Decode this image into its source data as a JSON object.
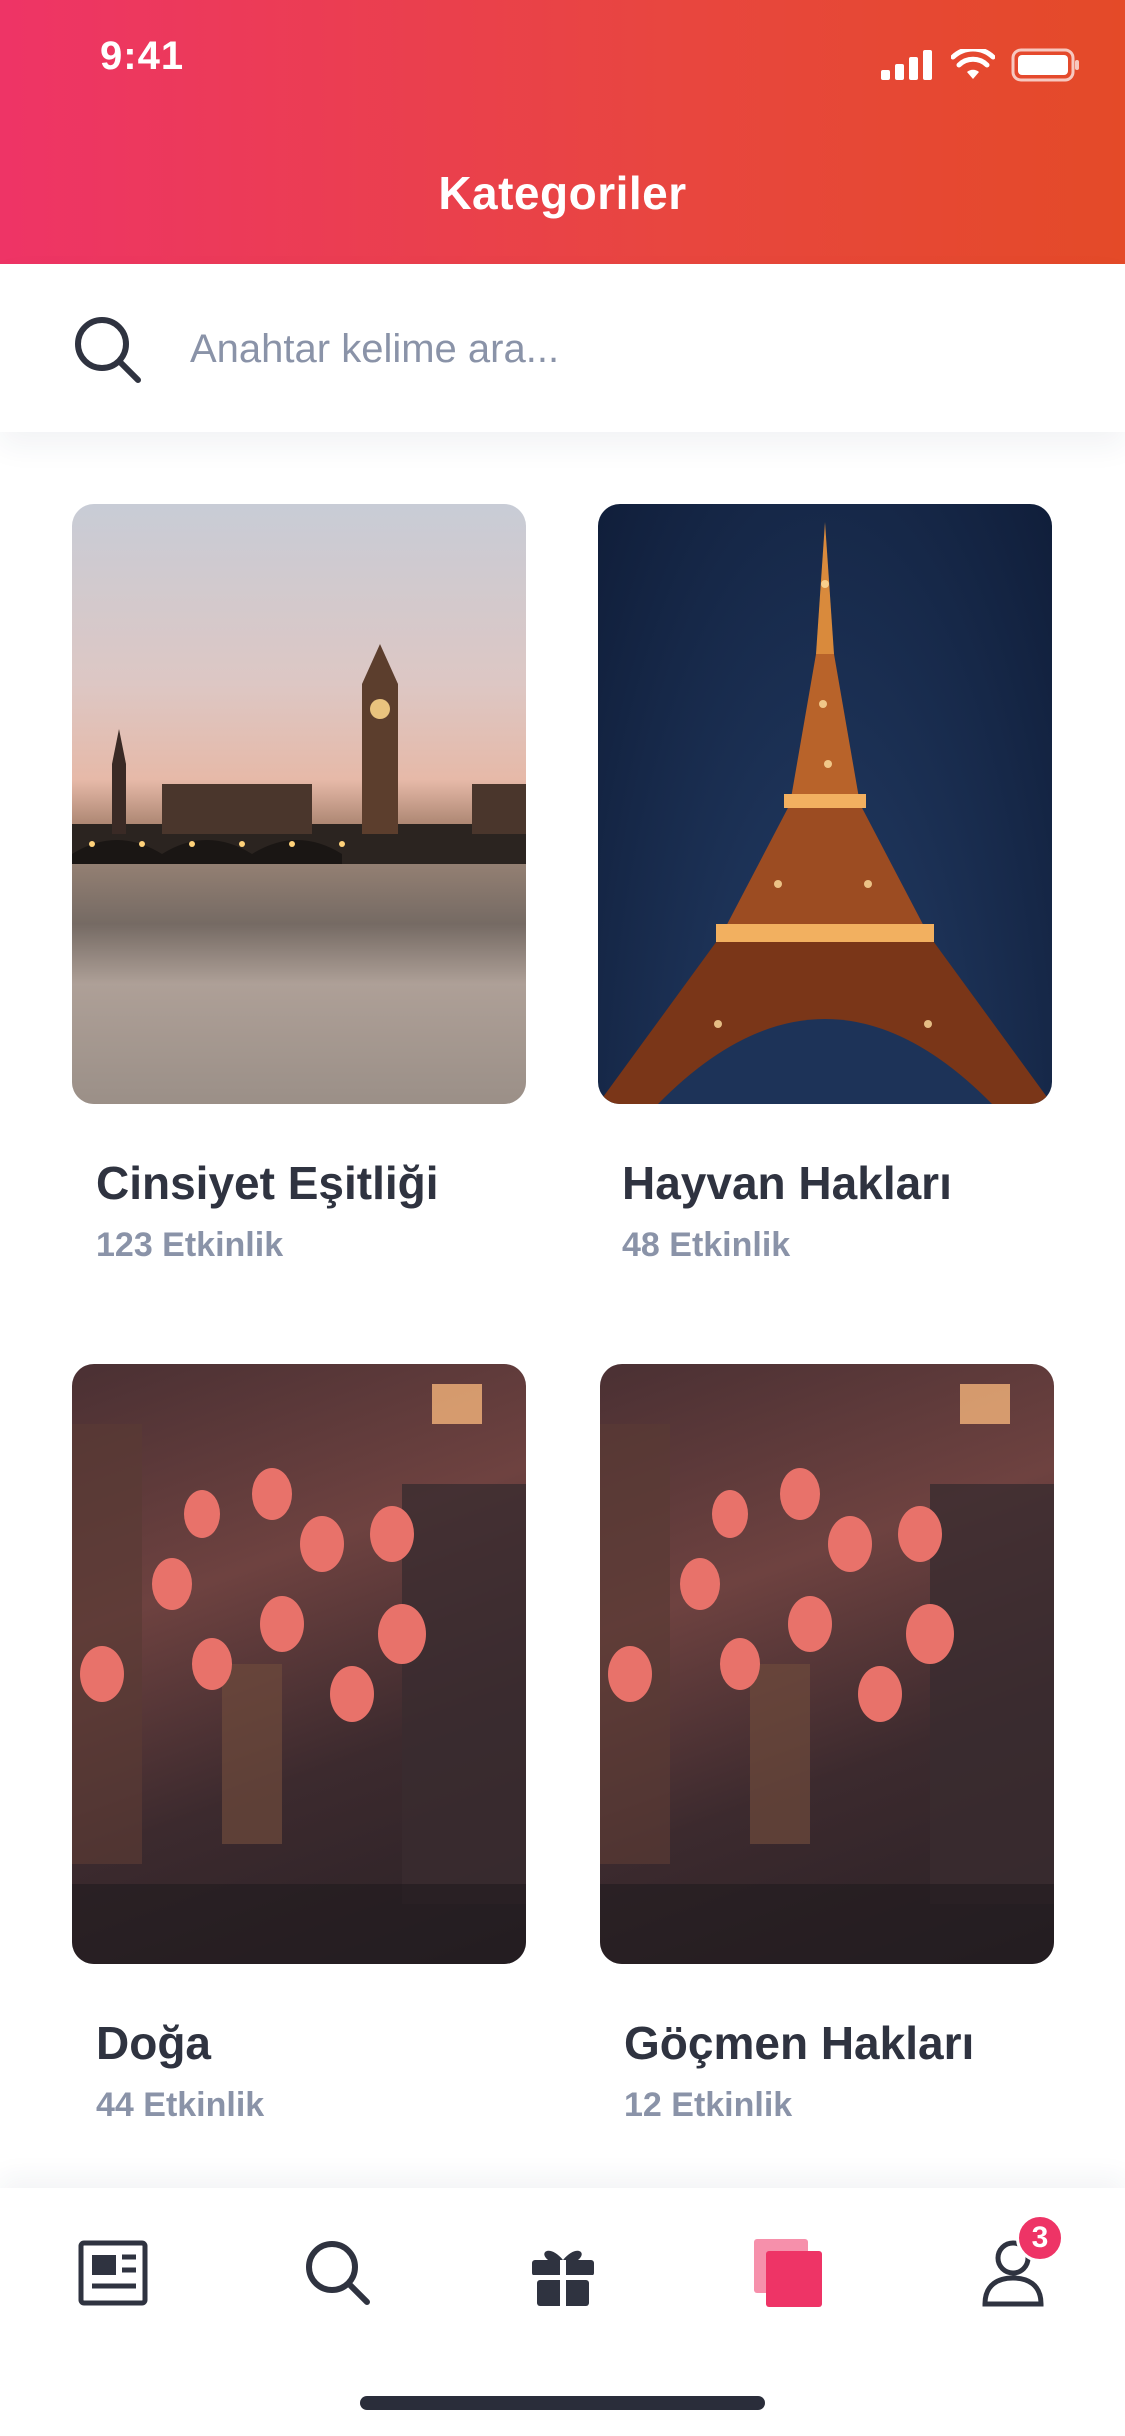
{
  "status_bar": {
    "time": "9:41"
  },
  "header": {
    "title": "Kategoriler"
  },
  "search": {
    "placeholder": "Anahtar kelime ara..."
  },
  "categories": [
    {
      "title": "Cinsiyet Eşitliği",
      "count": "123 Etkinlik"
    },
    {
      "title": "Hayvan Hakları",
      "count": "48 Etkinlik"
    },
    {
      "title": "Doğa",
      "count": "44 Etkinlik"
    },
    {
      "title": "Göçmen Hakları",
      "count": "12 Etkinlik"
    }
  ],
  "tabbar": {
    "items": [
      "news-icon",
      "search-icon",
      "gift-icon",
      "categories-icon",
      "profile-icon"
    ],
    "active": "categories-icon",
    "profile_badge": "3"
  },
  "colors": {
    "accent": "#ee3466",
    "header_end": "#e44a28",
    "text": "#2f3340",
    "muted": "#8a93a8"
  }
}
